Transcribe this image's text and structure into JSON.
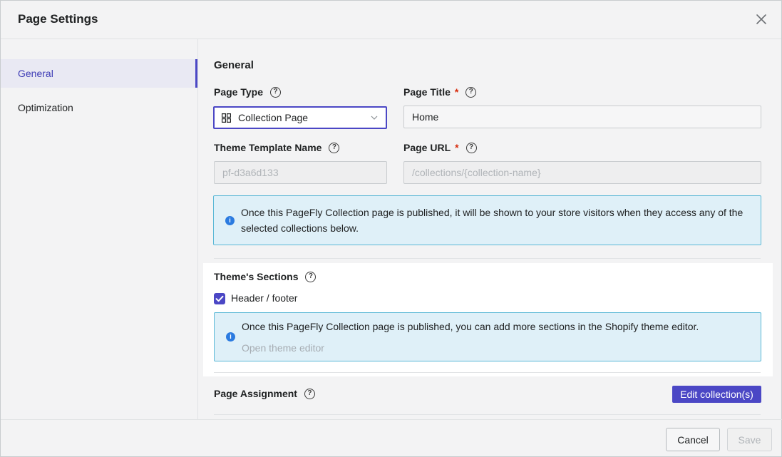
{
  "modal": {
    "title": "Page Settings"
  },
  "sidebar": {
    "items": [
      {
        "label": "General",
        "active": true
      },
      {
        "label": "Optimization",
        "active": false
      }
    ]
  },
  "general": {
    "section_title": "General",
    "page_type": {
      "label": "Page Type",
      "value": "Collection Page"
    },
    "page_title": {
      "label": "Page Title",
      "required_mark": "*",
      "value": "Home"
    },
    "theme_template": {
      "label": "Theme Template Name",
      "placeholder": "pf-d3a6d133"
    },
    "page_url": {
      "label": "Page URL",
      "required_mark": "*",
      "placeholder": "/collections/{collection-name}"
    },
    "info_banner": "Once this PageFly Collection page is published, it will be shown to your store visitors when they access any of the selected collections below."
  },
  "theme_sections": {
    "label": "Theme's Sections",
    "checkbox_label": "Header / footer",
    "checked": true,
    "banner_text": "Once this PageFly Collection page is published, you can add more sections in the Shopify theme editor.",
    "banner_link": "Open theme editor"
  },
  "page_assignment": {
    "label": "Page Assignment",
    "button": "Edit collection(s)"
  },
  "footer": {
    "cancel": "Cancel",
    "save": "Save"
  },
  "colors": {
    "accent": "#4b47c5",
    "info": "#2b7be0",
    "required": "#d72c0d"
  }
}
